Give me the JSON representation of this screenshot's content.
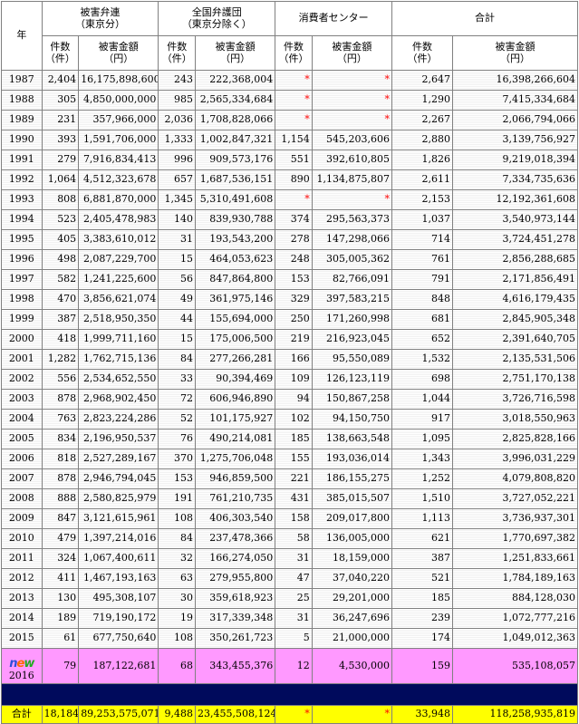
{
  "headers": {
    "year": "年",
    "group1": "被害弁連\n（東京分）",
    "group2": "全国弁護団\n（東京分除く）",
    "group3": "消費者センター",
    "group4": "合計",
    "count": "件数\n（件）",
    "amount": "被害金額\n（円）"
  },
  "rows": [
    {
      "year": "1987",
      "c1": "2,404",
      "a1": "16,175,898,600",
      "c2": "243",
      "a2": "222,368,004",
      "c3": "*",
      "a3": "*",
      "c4": "2,647",
      "a4": "16,398,266,604"
    },
    {
      "year": "1988",
      "c1": "305",
      "a1": "4,850,000,000",
      "c2": "985",
      "a2": "2,565,334,684",
      "c3": "*",
      "a3": "*",
      "c4": "1,290",
      "a4": "7,415,334,684"
    },
    {
      "year": "1989",
      "c1": "231",
      "a1": "357,966,000",
      "c2": "2,036",
      "a2": "1,708,828,066",
      "c3": "*",
      "a3": "*",
      "c4": "2,267",
      "a4": "2,066,794,066"
    },
    {
      "year": "1990",
      "c1": "393",
      "a1": "1,591,706,000",
      "c2": "1,333",
      "a2": "1,002,847,321",
      "c3": "1,154",
      "a3": "545,203,606",
      "c4": "2,880",
      "a4": "3,139,756,927"
    },
    {
      "year": "1991",
      "c1": "279",
      "a1": "7,916,834,413",
      "c2": "996",
      "a2": "909,573,176",
      "c3": "551",
      "a3": "392,610,805",
      "c4": "1,826",
      "a4": "9,219,018,394"
    },
    {
      "year": "1992",
      "c1": "1,064",
      "a1": "4,512,323,678",
      "c2": "657",
      "a2": "1,687,536,151",
      "c3": "890",
      "a3": "1,134,875,807",
      "c4": "2,611",
      "a4": "7,334,735,636"
    },
    {
      "year": "1993",
      "c1": "808",
      "a1": "6,881,870,000",
      "c2": "1,345",
      "a2": "5,310,491,608",
      "c3": "*",
      "a3": "*",
      "c4": "2,153",
      "a4": "12,192,361,608"
    },
    {
      "year": "1994",
      "c1": "523",
      "a1": "2,405,478,983",
      "c2": "140",
      "a2": "839,930,788",
      "c3": "374",
      "a3": "295,563,373",
      "c4": "1,037",
      "a4": "3,540,973,144"
    },
    {
      "year": "1995",
      "c1": "405",
      "a1": "3,383,610,012",
      "c2": "31",
      "a2": "193,543,200",
      "c3": "278",
      "a3": "147,298,066",
      "c4": "714",
      "a4": "3,724,451,278"
    },
    {
      "year": "1996",
      "c1": "498",
      "a1": "2,087,229,700",
      "c2": "15",
      "a2": "464,053,623",
      "c3": "248",
      "a3": "305,005,362",
      "c4": "761",
      "a4": "2,856,288,685"
    },
    {
      "year": "1997",
      "c1": "582",
      "a1": "1,241,225,600",
      "c2": "56",
      "a2": "847,864,800",
      "c3": "153",
      "a3": "82,766,091",
      "c4": "791",
      "a4": "2,171,856,491"
    },
    {
      "year": "1998",
      "c1": "470",
      "a1": "3,856,621,074",
      "c2": "49",
      "a2": "361,975,146",
      "c3": "329",
      "a3": "397,583,215",
      "c4": "848",
      "a4": "4,616,179,435"
    },
    {
      "year": "1999",
      "c1": "387",
      "a1": "2,518,950,350",
      "c2": "44",
      "a2": "155,694,000",
      "c3": "250",
      "a3": "171,260,998",
      "c4": "681",
      "a4": "2,845,905,348"
    },
    {
      "year": "2000",
      "c1": "418",
      "a1": "1,999,711,160",
      "c2": "15",
      "a2": "175,006,500",
      "c3": "219",
      "a3": "216,923,045",
      "c4": "652",
      "a4": "2,391,640,705"
    },
    {
      "year": "2001",
      "c1": "1,282",
      "a1": "1,762,715,136",
      "c2": "84",
      "a2": "277,266,281",
      "c3": "166",
      "a3": "95,550,089",
      "c4": "1,532",
      "a4": "2,135,531,506"
    },
    {
      "year": "2002",
      "c1": "556",
      "a1": "2,534,652,550",
      "c2": "33",
      "a2": "90,394,469",
      "c3": "109",
      "a3": "126,123,119",
      "c4": "698",
      "a4": "2,751,170,138"
    },
    {
      "year": "2003",
      "c1": "878",
      "a1": "2,968,902,450",
      "c2": "72",
      "a2": "606,946,890",
      "c3": "94",
      "a3": "150,867,258",
      "c4": "1,044",
      "a4": "3,726,716,598"
    },
    {
      "year": "2004",
      "c1": "763",
      "a1": "2,823,224,286",
      "c2": "52",
      "a2": "101,175,927",
      "c3": "102",
      "a3": "94,150,750",
      "c4": "917",
      "a4": "3,018,550,963"
    },
    {
      "year": "2005",
      "c1": "834",
      "a1": "2,196,950,537",
      "c2": "76",
      "a2": "490,214,081",
      "c3": "185",
      "a3": "138,663,548",
      "c4": "1,095",
      "a4": "2,825,828,166"
    },
    {
      "year": "2006",
      "c1": "818",
      "a1": "2,527,289,167",
      "c2": "370",
      "a2": "1,275,706,048",
      "c3": "155",
      "a3": "193,036,014",
      "c4": "1,343",
      "a4": "3,996,031,229"
    },
    {
      "year": "2007",
      "c1": "878",
      "a1": "2,946,794,045",
      "c2": "153",
      "a2": "946,859,500",
      "c3": "221",
      "a3": "186,155,275",
      "c4": "1,252",
      "a4": "4,079,808,820"
    },
    {
      "year": "2008",
      "c1": "888",
      "a1": "2,580,825,979",
      "c2": "191",
      "a2": "761,210,735",
      "c3": "431",
      "a3": "385,015,507",
      "c4": "1,510",
      "a4": "3,727,052,221"
    },
    {
      "year": "2009",
      "c1": "847",
      "a1": "3,121,615,961",
      "c2": "108",
      "a2": "406,303,540",
      "c3": "158",
      "a3": "209,017,800",
      "c4": "1,113",
      "a4": "3,736,937,301"
    },
    {
      "year": "2010",
      "c1": "479",
      "a1": "1,397,214,016",
      "c2": "84",
      "a2": "237,478,366",
      "c3": "58",
      "a3": "136,005,000",
      "c4": "621",
      "a4": "1,770,697,382"
    },
    {
      "year": "2011",
      "c1": "324",
      "a1": "1,067,400,611",
      "c2": "32",
      "a2": "166,274,050",
      "c3": "31",
      "a3": "18,159,000",
      "c4": "387",
      "a4": "1,251,833,661"
    },
    {
      "year": "2012",
      "c1": "411",
      "a1": "1,467,193,163",
      "c2": "63",
      "a2": "279,955,800",
      "c3": "47",
      "a3": "37,040,220",
      "c4": "521",
      "a4": "1,784,189,163"
    },
    {
      "year": "2013",
      "c1": "130",
      "a1": "495,308,107",
      "c2": "30",
      "a2": "359,618,923",
      "c3": "25",
      "a3": "29,201,000",
      "c4": "185",
      "a4": "884,128,030"
    },
    {
      "year": "2014",
      "c1": "189",
      "a1": "719,190,172",
      "c2": "19",
      "a2": "317,339,348",
      "c3": "31",
      "a3": "36,247,696",
      "c4": "239",
      "a4": "1,072,777,216"
    },
    {
      "year": "2015",
      "c1": "61",
      "a1": "677,750,640",
      "c2": "108",
      "a2": "350,261,723",
      "c3": "5",
      "a3": "21,000,000",
      "c4": "174",
      "a4": "1,049,012,363"
    }
  ],
  "latest": {
    "badge_n": "n",
    "badge_e": "e",
    "badge_w": "w",
    "year": "2016",
    "c1": "79",
    "a1": "187,122,681",
    "c2": "68",
    "a2": "343,455,376",
    "c3": "12",
    "a3": "4,530,000",
    "c4": "159",
    "a4": "535,108,057"
  },
  "total": {
    "label": "合計",
    "c1": "18,184",
    "a1": "89,253,575,071",
    "c2": "9,488",
    "a2": "23,455,508,124",
    "c3": "*",
    "a3": "*",
    "c4": "33,948",
    "a4": "118,258,935,819"
  },
  "colors": {
    "star": "#ff0000",
    "latest_row": "#ff99ff",
    "separator": "#000a5c",
    "total_row": "#ffff00"
  }
}
